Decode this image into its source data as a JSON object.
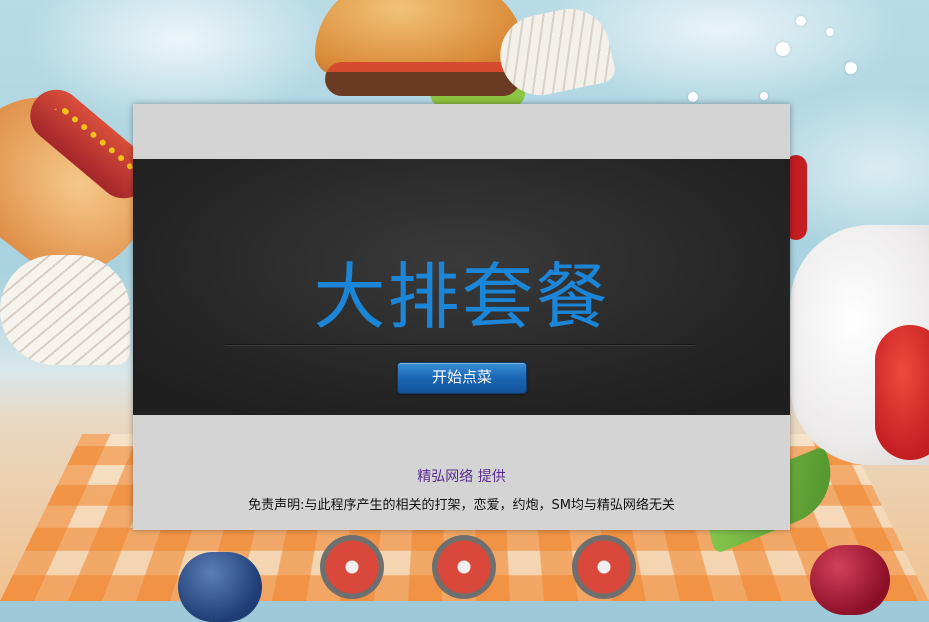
{
  "panel": {
    "title": "大排套餐",
    "start_button_label": "开始点菜",
    "provider_text": "精弘网络 提供",
    "disclaimer_text": "免责声明:与此程序产生的相关的打架，恋爱，约炮，SM均与精弘网络无关"
  },
  "colors": {
    "title_accent": "#1b86d8",
    "button_blue": "#1a66b5",
    "provider_purple": "#5b2d91",
    "panel_gray": "#d4d4d4",
    "band_dark": "#262626"
  },
  "background": {
    "icons": [
      "burger-icon",
      "hotdog-icon",
      "wing-icon",
      "ice-cream-icon",
      "strawberry-icon",
      "cherry-icon",
      "blueberry-icon",
      "wheel-icon"
    ]
  }
}
